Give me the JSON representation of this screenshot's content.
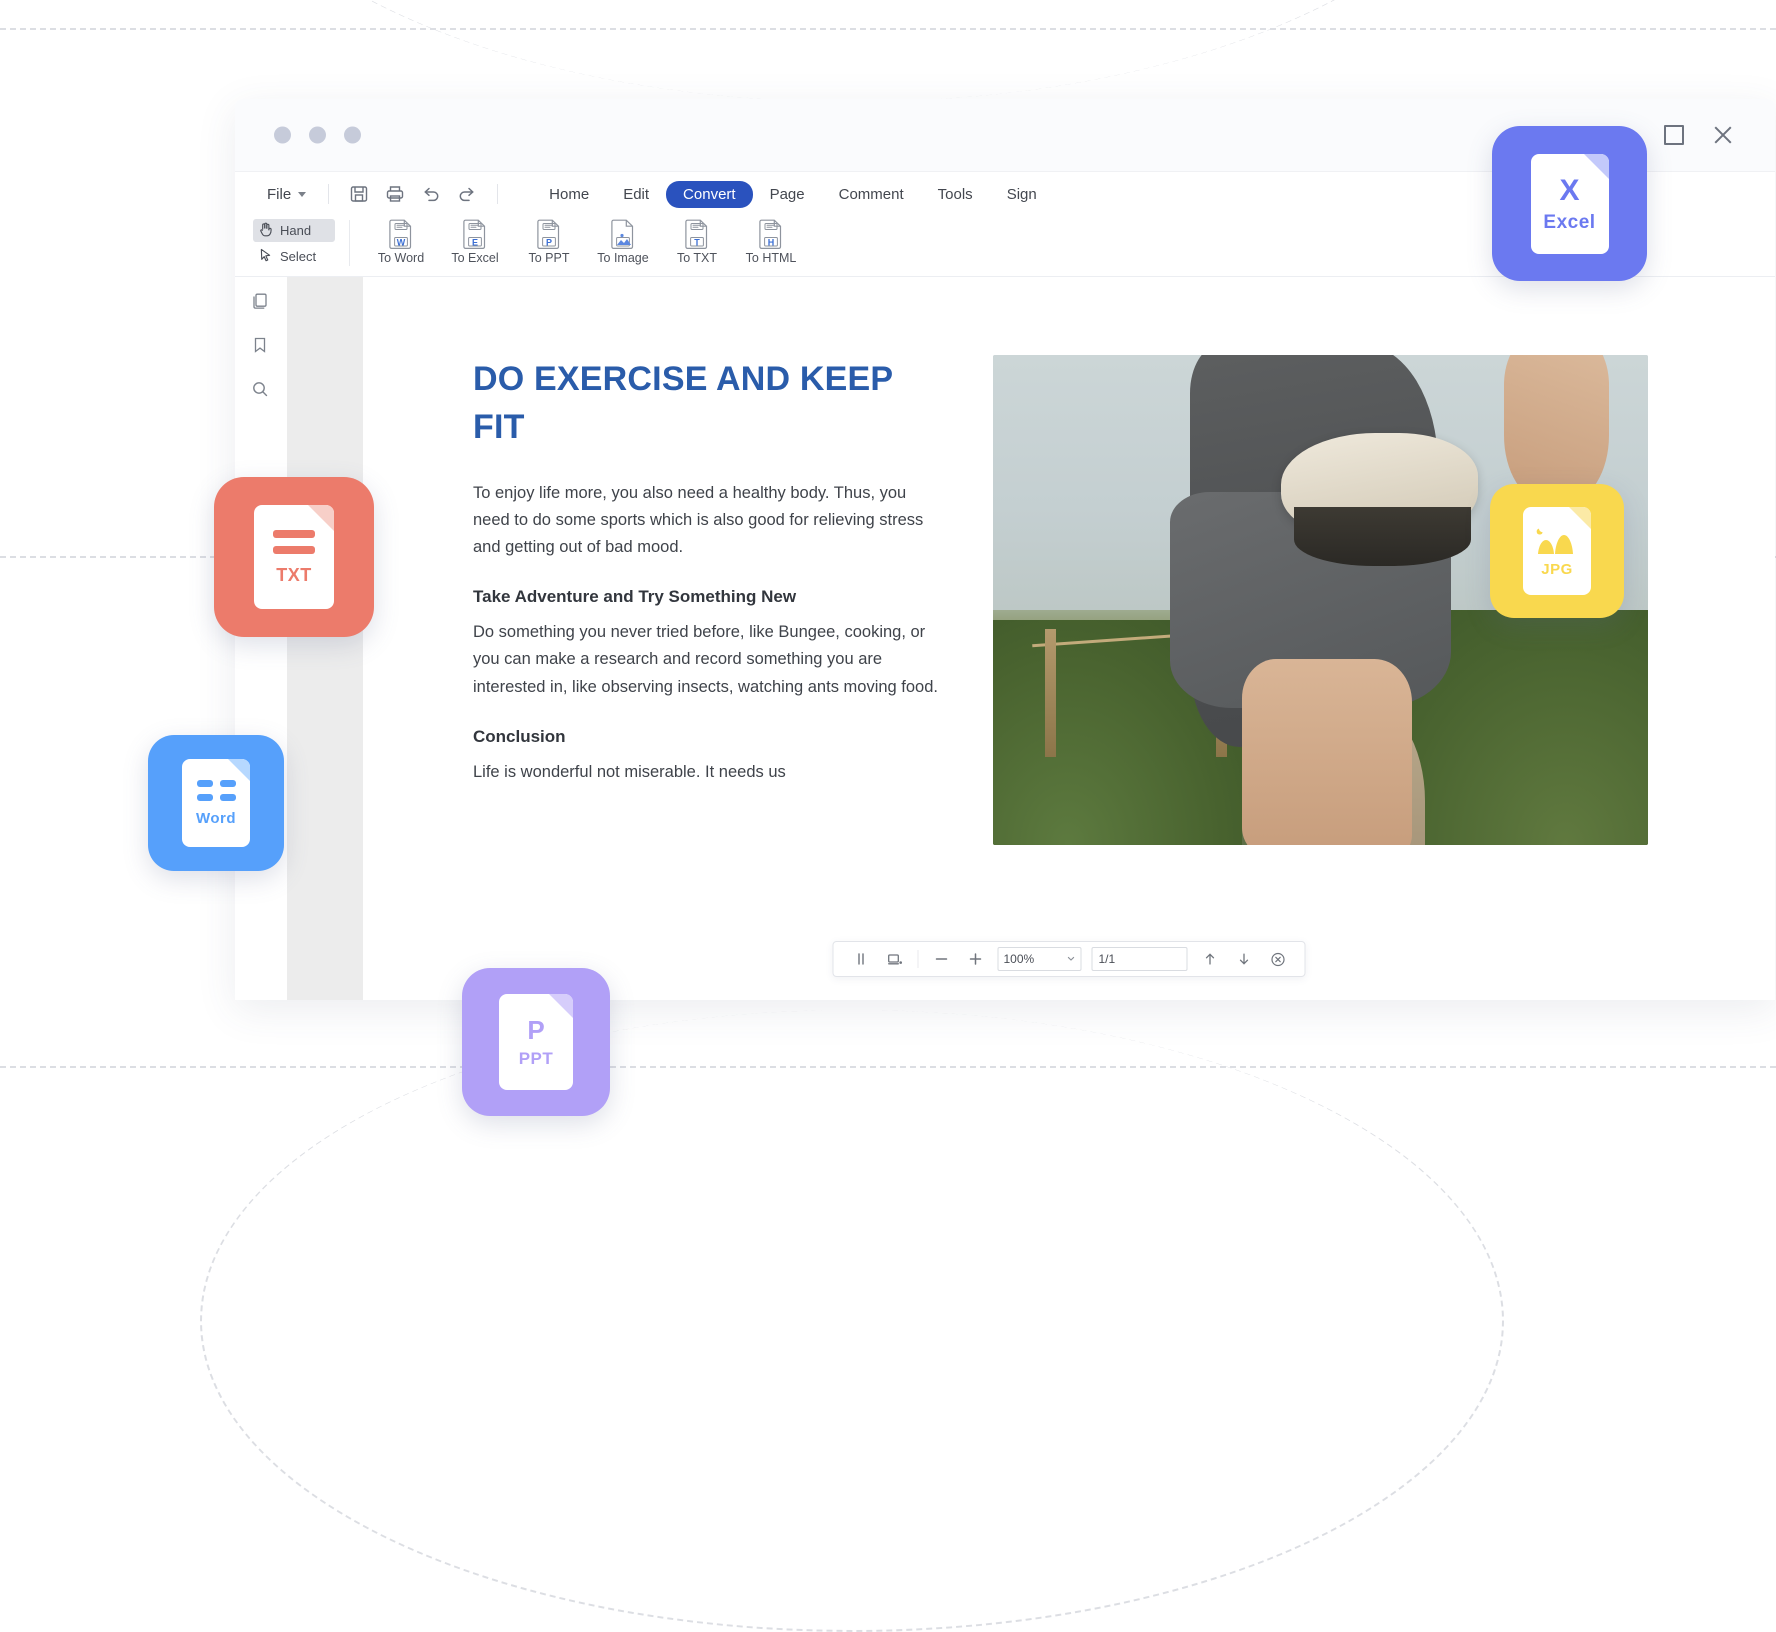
{
  "window": {
    "controls": {
      "minimize": "minimize-button",
      "maximize": "maximize-button",
      "close": "close-button"
    }
  },
  "menubar": {
    "file_label": "File",
    "quick_icons": [
      "save-icon",
      "print-icon",
      "undo-icon",
      "redo-icon"
    ],
    "items": [
      {
        "label": "Home",
        "active": false
      },
      {
        "label": "Edit",
        "active": false
      },
      {
        "label": "Convert",
        "active": true
      },
      {
        "label": "Page",
        "active": false
      },
      {
        "label": "Comment",
        "active": false
      },
      {
        "label": "Tools",
        "active": false
      },
      {
        "label": "Sign",
        "active": false
      }
    ]
  },
  "ribbon": {
    "modes": [
      {
        "label": "Hand",
        "icon": "hand-icon",
        "selected": true
      },
      {
        "label": "Select",
        "icon": "cursor-arrow-icon",
        "selected": false
      }
    ],
    "convert_buttons": [
      {
        "label": "To Word",
        "icon": "file-word-icon",
        "letter": "W"
      },
      {
        "label": "To Excel",
        "icon": "file-excel-icon",
        "letter": "E"
      },
      {
        "label": "To PPT",
        "icon": "file-ppt-icon",
        "letter": "P"
      },
      {
        "label": "To Image",
        "icon": "file-image-icon",
        "letter": ""
      },
      {
        "label": "To TXT",
        "icon": "file-txt-icon",
        "letter": "T"
      },
      {
        "label": "To HTML",
        "icon": "file-html-icon",
        "letter": "H"
      }
    ]
  },
  "left_rail": {
    "items": [
      {
        "icon": "pages-thumbnail-icon"
      },
      {
        "icon": "bookmark-icon"
      },
      {
        "icon": "search-icon"
      }
    ]
  },
  "document": {
    "title": "DO EXERCISE AND KEEP FIT",
    "paragraph_1": "To enjoy life more, you also need a healthy body. Thus, you need to do some sports which is also good for relieving stress and getting out of bad mood.",
    "heading_2": "Take Adventure and Try Something New",
    "paragraph_2": "Do something you never tried before, like Bungee, cooking, or you can make a research and record something you are interested in, like observing insects, watching ants moving food.",
    "heading_3": "Conclusion",
    "paragraph_3": "Life is wonderful not miserable. It needs us",
    "photo_alt": "person-stretching-leg-outdoors-photo",
    "title_color": "#2a5caa"
  },
  "statusbar": {
    "split_view_icon": "split-view-icon",
    "page_layout_icon": "page-layout-icon",
    "zoom_out_label": "−",
    "zoom_in_label": "+",
    "zoom_value": "100%",
    "page_value": "1/1",
    "prev_page_icon": "arrow-up-icon",
    "next_page_icon": "arrow-down-icon",
    "close_bar_icon": "close-circle-icon"
  },
  "badges": [
    {
      "id": "excel",
      "name": "Excel",
      "letter": "X",
      "tile_color": "#6b79f0",
      "fold_color": "#c3c9fb",
      "text_color": "#6b79f0",
      "glyph": "letter"
    },
    {
      "id": "jpg",
      "name": "JPG",
      "letter": "",
      "tile_color": "#f9d84e",
      "fold_color": "#fbeaa6",
      "text_color": "#f9d84e",
      "glyph": "image"
    },
    {
      "id": "txt",
      "name": "TXT",
      "letter": "",
      "tile_color": "#ec7b6b",
      "fold_color": "#f7cfc8",
      "text_color": "#ec7b6b",
      "glyph": "lines"
    },
    {
      "id": "word",
      "name": "Word",
      "letter": "",
      "tile_color": "#56a0fb",
      "fold_color": "#b6d8ff",
      "text_color": "#56a0fb",
      "glyph": "lines2"
    },
    {
      "id": "ppt",
      "name": "PPT",
      "letter": "P",
      "tile_color": "#b1a0f7",
      "fold_color": "#d6cdfb",
      "text_color": "#b1a0f7",
      "glyph": "letter"
    }
  ]
}
